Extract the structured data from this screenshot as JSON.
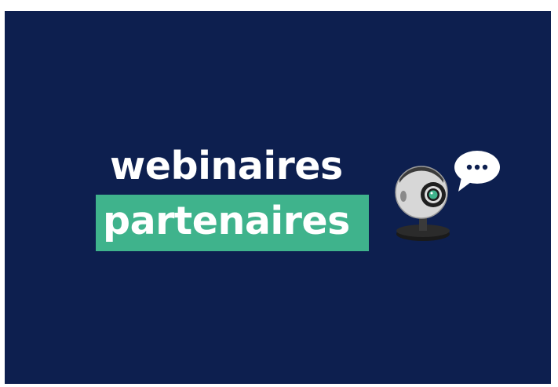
{
  "banner": {
    "line1": "webinaires",
    "line2": "partenaires",
    "colors": {
      "background": "#0d1f4f",
      "highlight": "#3fb38c",
      "text": "#ffffff"
    },
    "illustration": {
      "icon": "webcam-icon",
      "bubble_icon": "speech-bubble-icon"
    }
  }
}
